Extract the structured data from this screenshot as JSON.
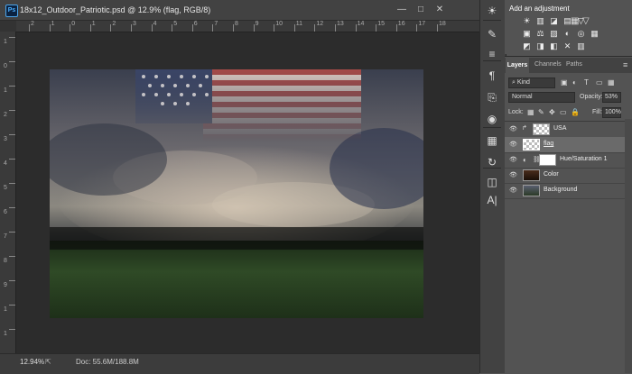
{
  "document": {
    "title": "18x12_Outdoor_Patriotic.psd @ 12.9% (flag, RGB/8)",
    "app_badge": "Ps",
    "minimize": "—",
    "maximize": "□",
    "close": "✕",
    "h_ruler_numbers": [
      "2",
      "1",
      "0",
      "1",
      "2",
      "3",
      "4",
      "5",
      "6",
      "7",
      "8",
      "9",
      "10",
      "11",
      "12",
      "13",
      "14",
      "15",
      "16",
      "17",
      "18"
    ],
    "v_ruler_numbers": [
      "1",
      "0",
      "1",
      "2",
      "3",
      "4",
      "5",
      "6",
      "7",
      "8",
      "9",
      "1",
      "1"
    ],
    "zoom": "12.94%",
    "doc_size": "Doc: 55.6M/188.8M"
  },
  "tools": [
    {
      "icon": "brightness-icon",
      "glyph": "☀"
    },
    {
      "icon": "brush-icon",
      "glyph": "✎"
    },
    {
      "icon": "sliders-icon",
      "glyph": "≡"
    },
    {
      "icon": "paragraph-icon",
      "glyph": "¶"
    },
    {
      "icon": "clone-icon",
      "glyph": "⎘"
    },
    {
      "icon": "palette-icon",
      "glyph": "◉"
    },
    {
      "icon": "grid-icon",
      "glyph": "▦"
    },
    {
      "icon": "history-icon",
      "glyph": "↻"
    },
    {
      "icon": "layers-icon",
      "glyph": "◫"
    },
    {
      "icon": "character-icon",
      "glyph": "A|"
    }
  ],
  "adjustments": {
    "title": "Add an adjustment",
    "row1": [
      "☀",
      "▥",
      "◪",
      "▤",
      "▽"
    ],
    "row2": [
      "▣",
      "⚖",
      "▨",
      "◐",
      "◎",
      "▦"
    ],
    "row3": [
      "◩",
      "◨",
      "◧",
      "✕",
      "▥"
    ]
  },
  "layers_panel": {
    "tabs": [
      "Layers",
      "Channels",
      "Paths"
    ],
    "menu_icon": "≡",
    "kind_label": "Kind",
    "filter_icons": [
      "▣",
      "◐",
      "T",
      "▭",
      "▦"
    ],
    "blend_mode": "Normal",
    "opacity_label": "Opacity:",
    "opacity_value": "53%",
    "lock_label": "Lock:",
    "lock_icons": [
      "▦",
      "✎",
      "✥",
      "▭",
      "🔒"
    ],
    "fill_label": "Fill:",
    "fill_value": "100%",
    "layers": [
      {
        "name": "USA",
        "visible": true,
        "selected": false
      },
      {
        "name": "flag",
        "visible": true,
        "selected": true
      },
      {
        "name": "Hue/Saturation 1",
        "visible": true,
        "selected": false
      },
      {
        "name": "Color",
        "visible": true,
        "selected": false
      },
      {
        "name": "Background",
        "visible": true,
        "selected": false
      }
    ]
  }
}
